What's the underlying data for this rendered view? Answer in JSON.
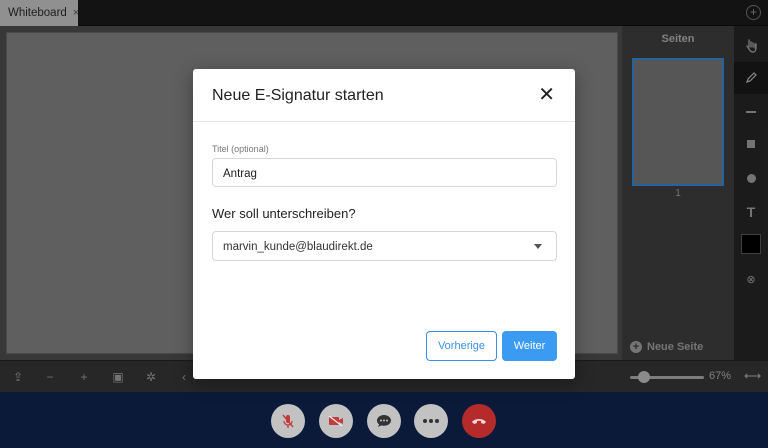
{
  "tabs": [
    {
      "label": "Whiteboard",
      "close": "×"
    }
  ],
  "tabbar": {
    "add": "+"
  },
  "pages_panel": {
    "title": "Seiten",
    "pages": [
      {
        "number": "1"
      }
    ],
    "new_page_label": "Neue Seite"
  },
  "tools": [
    {
      "icon": "hand-icon",
      "glyph": "✋"
    },
    {
      "icon": "pencil-icon",
      "glyph": "✎",
      "active": true
    },
    {
      "icon": "line-icon",
      "glyph": "—"
    },
    {
      "icon": "square-icon",
      "glyph": "■"
    },
    {
      "icon": "circle-icon",
      "glyph": "●"
    },
    {
      "icon": "text-icon",
      "glyph": "T"
    },
    {
      "icon": "color-swatch",
      "color": "#000000"
    },
    {
      "icon": "clear-icon",
      "glyph": "⊗"
    }
  ],
  "bottombar": {
    "zoom_value": 67,
    "zoom_label": "67%"
  },
  "modal": {
    "title": "Neue E-Signatur starten",
    "close": "✕",
    "title_field_label": "Titel (optional)",
    "title_field_value": "Antrag",
    "question": "Wer soll unterschreiben?",
    "signer_selected": "marvin_kunde@blaudirekt.de",
    "prev_label": "Vorherige",
    "next_label": "Weiter"
  },
  "colors": {
    "accent": "#3b9af2",
    "hangup": "#b52b2b",
    "callbar": "#0c1a3a"
  }
}
